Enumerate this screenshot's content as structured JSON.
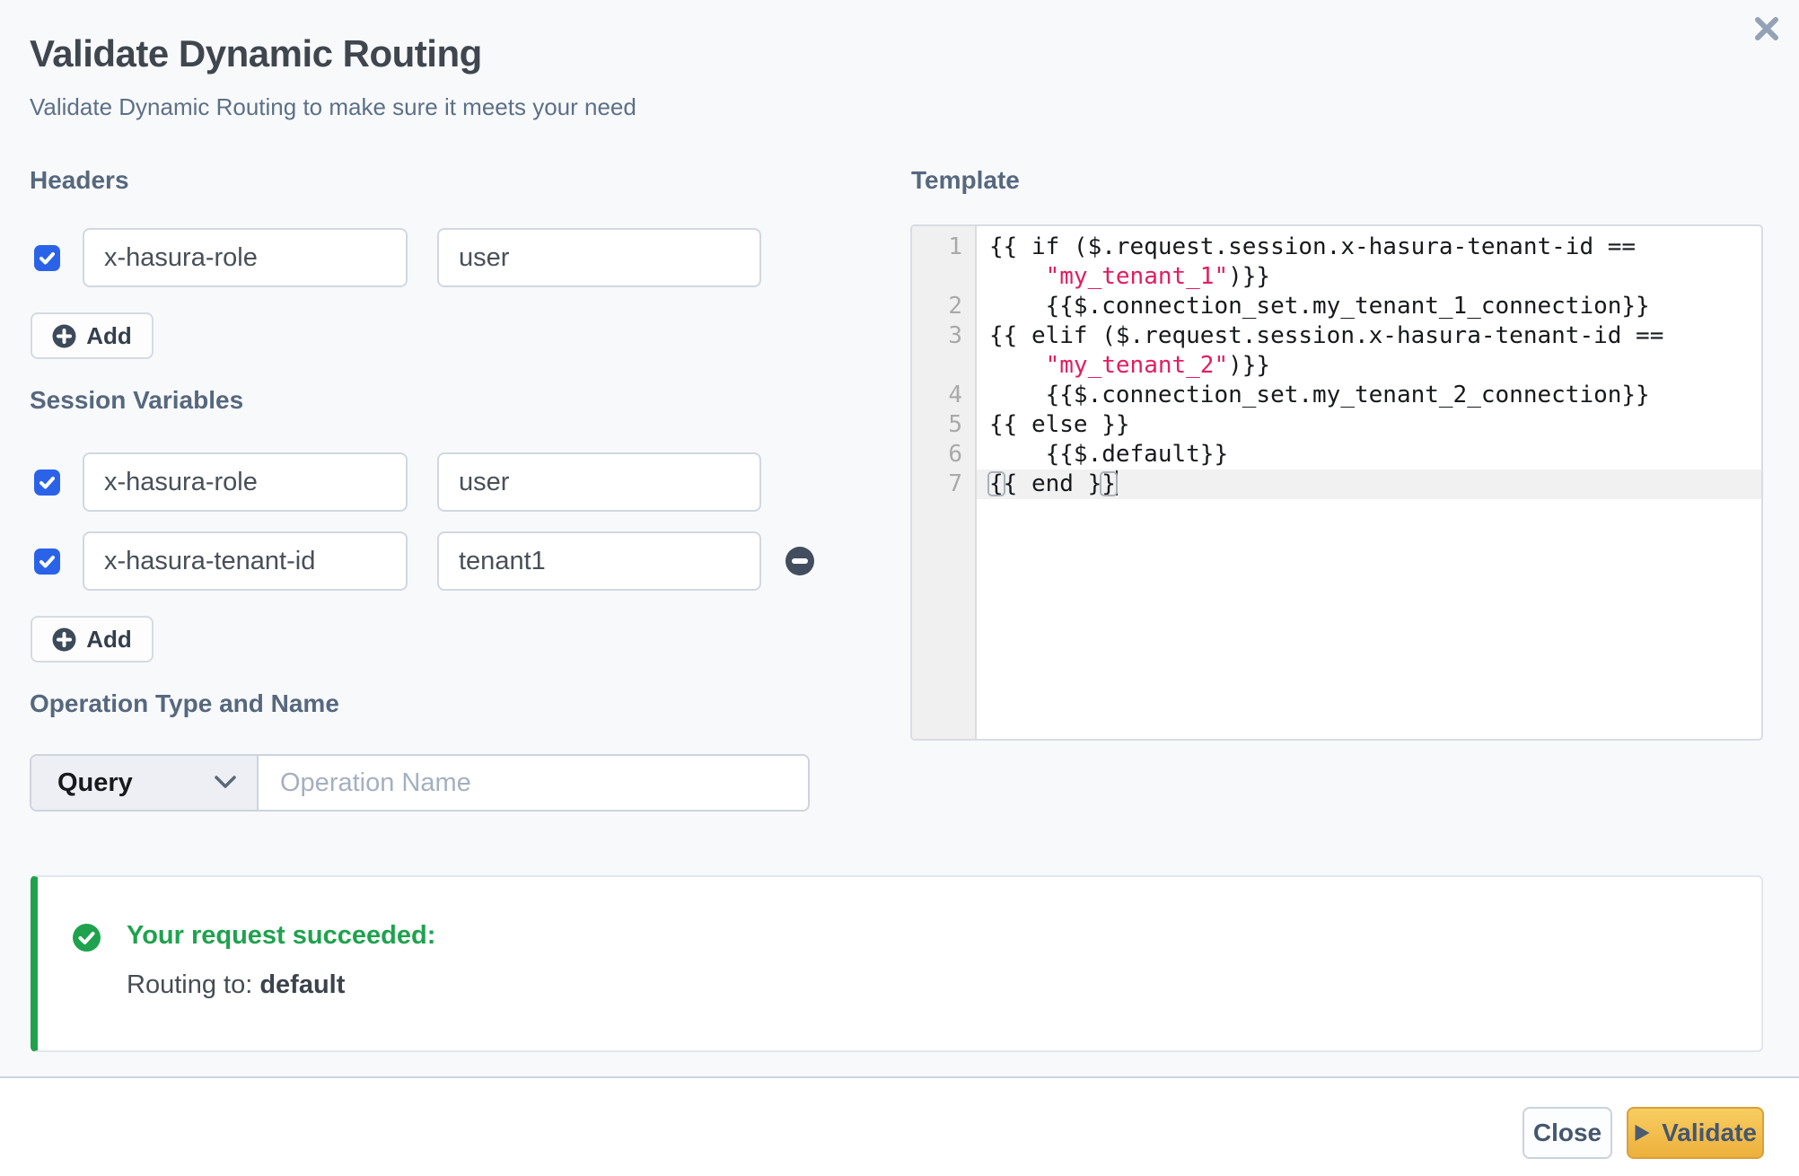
{
  "modal": {
    "title": "Validate Dynamic Routing",
    "subtitle": "Validate Dynamic Routing to make sure it meets your need"
  },
  "headers": {
    "label": "Headers",
    "add_label": "Add",
    "rows": [
      {
        "checked": true,
        "key": "x-hasura-role",
        "value": "user"
      }
    ]
  },
  "session_variables": {
    "label": "Session Variables",
    "add_label": "Add",
    "rows": [
      {
        "checked": true,
        "key": "x-hasura-role",
        "value": "user"
      },
      {
        "checked": true,
        "key": "x-hasura-tenant-id",
        "value": "tenant1"
      }
    ]
  },
  "operation": {
    "label": "Operation Type and Name",
    "type_value": "Query",
    "name_placeholder": "Operation Name"
  },
  "template": {
    "label": "Template",
    "code_rows": [
      {
        "num": "1",
        "segments": [
          {
            "c": "code",
            "t": "{{ if ($.request.session.x-hasura-tenant-id =="
          }
        ]
      },
      {
        "num": "",
        "segments": [
          {
            "c": "code",
            "t": "    "
          },
          {
            "c": "string",
            "t": "\"my_tenant_1\""
          },
          {
            "c": "code",
            "t": ")}}"
          }
        ]
      },
      {
        "num": "2",
        "segments": [
          {
            "c": "code",
            "t": "    {{$.connection_set.my_tenant_1_connection}}"
          }
        ]
      },
      {
        "num": "3",
        "segments": [
          {
            "c": "code",
            "t": "{{ elif ($.request.session.x-hasura-tenant-id =="
          }
        ]
      },
      {
        "num": "",
        "segments": [
          {
            "c": "code",
            "t": "    "
          },
          {
            "c": "string",
            "t": "\"my_tenant_2\""
          },
          {
            "c": "code",
            "t": ")}}"
          }
        ]
      },
      {
        "num": "4",
        "segments": [
          {
            "c": "code",
            "t": "    {{$.connection_set.my_tenant_2_connection}}"
          }
        ]
      },
      {
        "num": "5",
        "segments": [
          {
            "c": "code",
            "t": "{{ else }}"
          }
        ]
      },
      {
        "num": "6",
        "segments": [
          {
            "c": "code",
            "t": "    {{$.default}}"
          }
        ]
      },
      {
        "num": "7",
        "active": true,
        "segments": [
          {
            "c": "bracket",
            "t": "{"
          },
          {
            "c": "code",
            "t": "{ end }"
          },
          {
            "c": "bracket",
            "t": "}"
          },
          {
            "c": "cursor",
            "t": ""
          }
        ]
      }
    ]
  },
  "result": {
    "title": "Your request succeeded:",
    "routing_prefix": "Routing to: ",
    "routing_value": "default"
  },
  "footer": {
    "close_label": "Close",
    "validate_label": "Validate"
  },
  "colors": {
    "accent_blue": "#2b63e8",
    "success_green": "#1fa24e",
    "validate_yellow": "#edb03c",
    "code_string_red": "#e11d5e",
    "page_background": "#f8f9fb"
  }
}
